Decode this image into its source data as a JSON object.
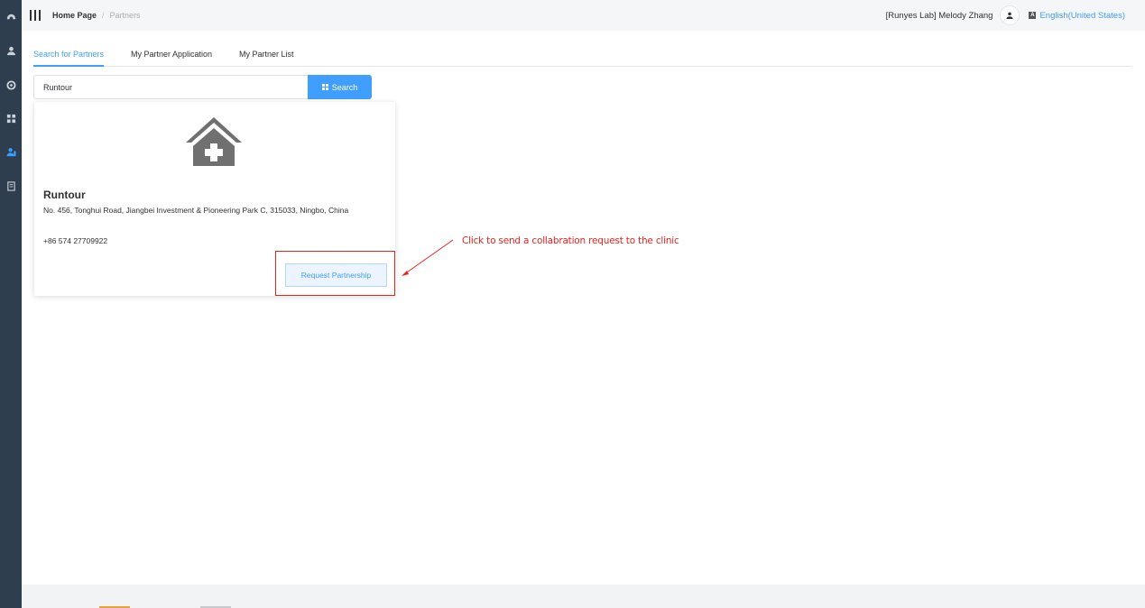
{
  "sidebar": {
    "items": [
      {
        "icon": "dashboard-icon",
        "active": false
      },
      {
        "icon": "user-icon",
        "active": false
      },
      {
        "icon": "settings-icon",
        "active": false
      },
      {
        "icon": "apps-icon",
        "active": false
      },
      {
        "icon": "partners-icon",
        "active": true
      },
      {
        "icon": "document-icon",
        "active": false
      }
    ]
  },
  "header": {
    "breadcrumb": {
      "home": "Home Page",
      "separator": "/",
      "current": "Partners"
    },
    "user": "[Runyes Lab] Melody Zhang",
    "language": "English(United States)"
  },
  "tabs": [
    {
      "label": "Search for Partners",
      "active": true
    },
    {
      "label": "My Partner Application",
      "active": false
    },
    {
      "label": "My Partner List",
      "active": false
    }
  ],
  "search": {
    "value": "Runtour",
    "button_label": "Search"
  },
  "result": {
    "name": "Runtour",
    "address": "No. 456, Tonghui Road, Jiangbei Investment & Pioneering Park C, 315033, Ningbo, China",
    "phone": "+86 574 27709922",
    "action_label": "Request Partnership",
    "icon": "clinic-house-icon"
  },
  "annotation": {
    "text": "Click to send a collabration request to the clinic",
    "color": "#e5251e"
  },
  "colors": {
    "accent": "#409eff",
    "sidebar": "#2f3e4f"
  }
}
